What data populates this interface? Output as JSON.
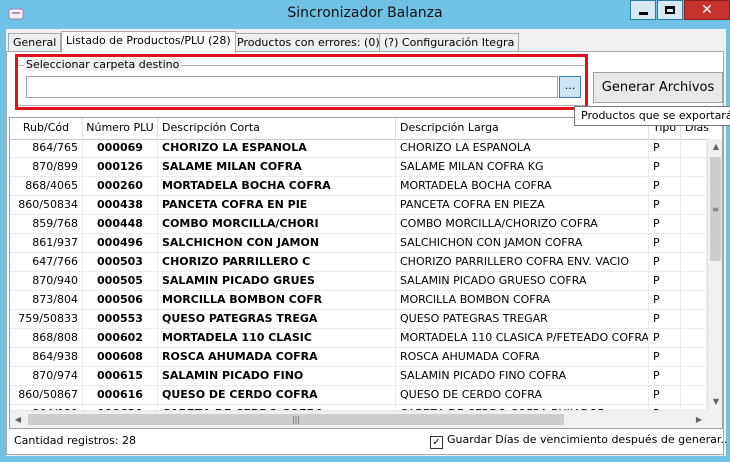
{
  "window": {
    "title": "Sincronizador Balanza",
    "close_glyph": "✕"
  },
  "tabs": [
    {
      "label": "General"
    },
    {
      "label": "Listado de Productos/PLU (28)"
    },
    {
      "label": "Productos con errores: (0)"
    },
    {
      "label": "(?) Configuración Itegra"
    }
  ],
  "destination": {
    "group_label": "Seleccionar carpeta destino",
    "path_value": "",
    "browse_label": "..."
  },
  "generate_button": "Generar Archivos",
  "tooltip": "Productos que se exportarán",
  "grid": {
    "columns": [
      "Rub/Cód",
      "Número PLU",
      "Descripción Corta",
      "Descripción Larga",
      "Tipo",
      "Días"
    ],
    "rows": [
      [
        "864/765",
        "000069",
        "CHORIZO LA ESPANOLA",
        "CHORIZO LA ESPANOLA",
        "P",
        ""
      ],
      [
        "870/899",
        "000126",
        "SALAME MILAN COFRA",
        "SALAME MILAN COFRA KG",
        "P",
        ""
      ],
      [
        "868/4065",
        "000260",
        "MORTADELA BOCHA COFRA",
        "MORTADELA BOCHA COFRA",
        "P",
        ""
      ],
      [
        "860/50834",
        "000438",
        "PANCETA COFRA EN PIE",
        "PANCETA COFRA EN PIEZA",
        "P",
        ""
      ],
      [
        "859/768",
        "000448",
        "COMBO MORCILLA/CHORI",
        "COMBO MORCILLA/CHORIZO COFRA",
        "P",
        ""
      ],
      [
        "861/937",
        "000496",
        "SALCHICHON CON JAMON",
        "SALCHICHON CON JAMON COFRA",
        "P",
        ""
      ],
      [
        "647/766",
        "000503",
        "CHORIZO PARRILLERO C",
        "CHORIZO PARRILLERO COFRA ENV. VACIO",
        "P",
        ""
      ],
      [
        "870/940",
        "000505",
        "SALAMIN PICADO GRUES",
        "SALAMIN PICADO GRUESO COFRA",
        "P",
        ""
      ],
      [
        "873/804",
        "000506",
        "MORCILLA BOMBON COFR",
        "MORCILLA BOMBON COFRA",
        "P",
        ""
      ],
      [
        "759/50833",
        "000553",
        "QUESO PATEGRAS TREGA",
        "QUESO PATEGRAS TREGAR",
        "P",
        ""
      ],
      [
        "868/808",
        "000602",
        "MORTADELA 110 CLASIC",
        "MORTADELA 110 CLASICA P/FETEADO COFRA",
        "P",
        ""
      ],
      [
        "864/938",
        "000608",
        "ROSCA AHUMADA COFRA",
        "ROSCA AHUMADA COFRA",
        "P",
        ""
      ],
      [
        "870/974",
        "000615",
        "SALAMIN PICADO FINO",
        "SALAMIN PICADO FINO COFRA",
        "P",
        ""
      ],
      [
        "860/50867",
        "000616",
        "QUESO DE CERDO COFRA",
        "QUESO DE CERDO COFRA",
        "P",
        ""
      ],
      [
        "864/939",
        "000620",
        "CABEZA DE CERDO COFRA",
        "CABEZA DE CERDO COFRA BUJIADOR",
        "P",
        ""
      ]
    ]
  },
  "status": {
    "count_label": "Cantidad registros: 28",
    "checkbox_checked": true,
    "checkbox_label": "Guardar Días de vencimiento después de generar.."
  },
  "colors": {
    "titlebar": "#6fc1e6",
    "highlight": "#e0101c",
    "close_button": "#c7332b"
  }
}
